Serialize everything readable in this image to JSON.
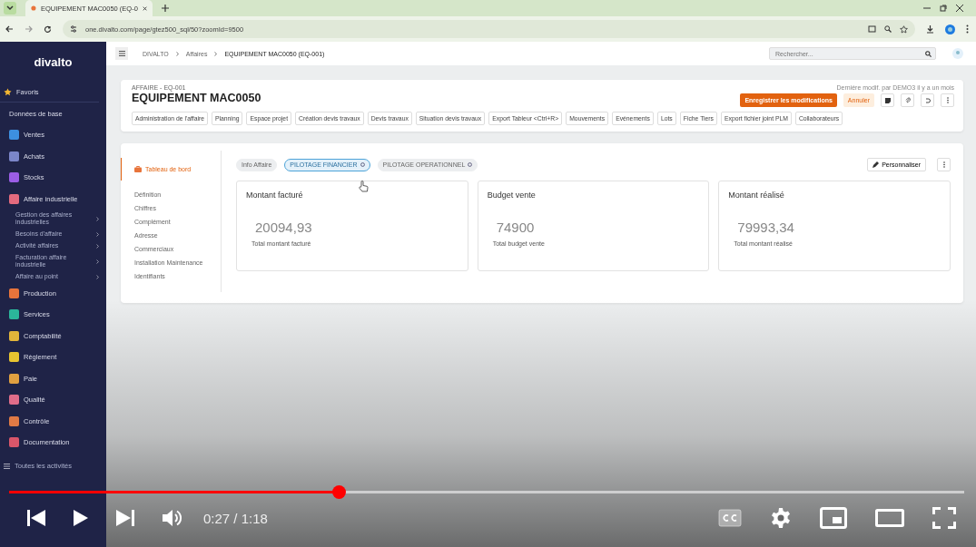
{
  "browser": {
    "tab_title": "EQUIPEMENT MAC0050 (EQ-0",
    "url": "one.divalto.com/page/gtez500_sql/50?zoomId=9500"
  },
  "sidebar": {
    "logo": "divalto",
    "favorites": "Favoris",
    "section": "Données de base",
    "items": [
      {
        "label": "Ventes",
        "color": "#3d8fe0"
      },
      {
        "label": "Achats",
        "color": "#7b86c9"
      },
      {
        "label": "Stocks",
        "color": "#9b5de5"
      },
      {
        "label": "Affaire industrielle",
        "color": "#e46a7e",
        "children": [
          {
            "label": "Gestion des affaires industrielles"
          },
          {
            "label": "Besoins d'affaire"
          },
          {
            "label": "Activité affaires"
          },
          {
            "label": "Facturation affaire industrielle"
          },
          {
            "label": "Affaire au point"
          }
        ]
      },
      {
        "label": "Production",
        "color": "#e8743b"
      },
      {
        "label": "Services",
        "color": "#2bb59a"
      },
      {
        "label": "Comptabilité",
        "color": "#e2b53a"
      },
      {
        "label": "Règlement",
        "color": "#e8c430"
      },
      {
        "label": "Paie",
        "color": "#e0a040"
      },
      {
        "label": "Qualité",
        "color": "#e06d8a"
      },
      {
        "label": "Contrôle",
        "color": "#e07a45"
      },
      {
        "label": "Documentation",
        "color": "#d9566a"
      }
    ],
    "footer": "Toutes les activités"
  },
  "header": {
    "breadcrumb": [
      "DIVALTO",
      "Affaires",
      "EQUIPEMENT MAC0050 (EQ-001)"
    ],
    "search_placeholder": "Rechercher..."
  },
  "record": {
    "overline": "AFFAIRE - EQ-001",
    "title": "EQUIPEMENT MAC0050",
    "last_modified": "Dernière modif. par DEMO3 il y a un mois",
    "save_button": "Enregistrer les modifications",
    "cancel_button": "Annuler",
    "actions": [
      "Administration de l'affaire",
      "Planning",
      "Espace projet",
      "Création devis travaux",
      "Devis travaux",
      "Situation devis travaux",
      "Export Tableur <Ctrl+R>",
      "Mouvements",
      "Evénements",
      "Lots",
      "Fiche Tiers",
      "Export fichier joint PLM",
      "Collaborateurs"
    ]
  },
  "dashboard": {
    "nav": [
      {
        "label": "Tableau de bord",
        "selected": true
      },
      {
        "label": "Définition",
        "selected": false
      },
      {
        "label": "Chiffres",
        "selected": false
      },
      {
        "label": "Complément",
        "selected": false
      },
      {
        "label": "Adresse",
        "selected": false
      },
      {
        "label": "Commerciaux",
        "selected": false
      },
      {
        "label": "Installation Maintenance",
        "selected": false
      },
      {
        "label": "Identifiants",
        "selected": false
      }
    ],
    "chips": [
      {
        "label": "Info Affaire",
        "selected": false,
        "settings": false
      },
      {
        "label": "PILOTAGE FINANCIER",
        "selected": true,
        "settings": true
      },
      {
        "label": "PILOTAGE OPERATIONNEL",
        "selected": false,
        "settings": true
      }
    ],
    "customize_button": "Personnaliser",
    "kpis": [
      {
        "title": "Montant facturé",
        "value": "20094,93",
        "caption": "Total montant facturé"
      },
      {
        "title": "Budget vente",
        "value": "74900",
        "caption": "Total budget vente"
      },
      {
        "title": "Montant réalisé",
        "value": "79993,34",
        "caption": "Total montant réalisé"
      }
    ]
  },
  "player": {
    "level": 0.345,
    "time": "0:27 / 1:18"
  }
}
